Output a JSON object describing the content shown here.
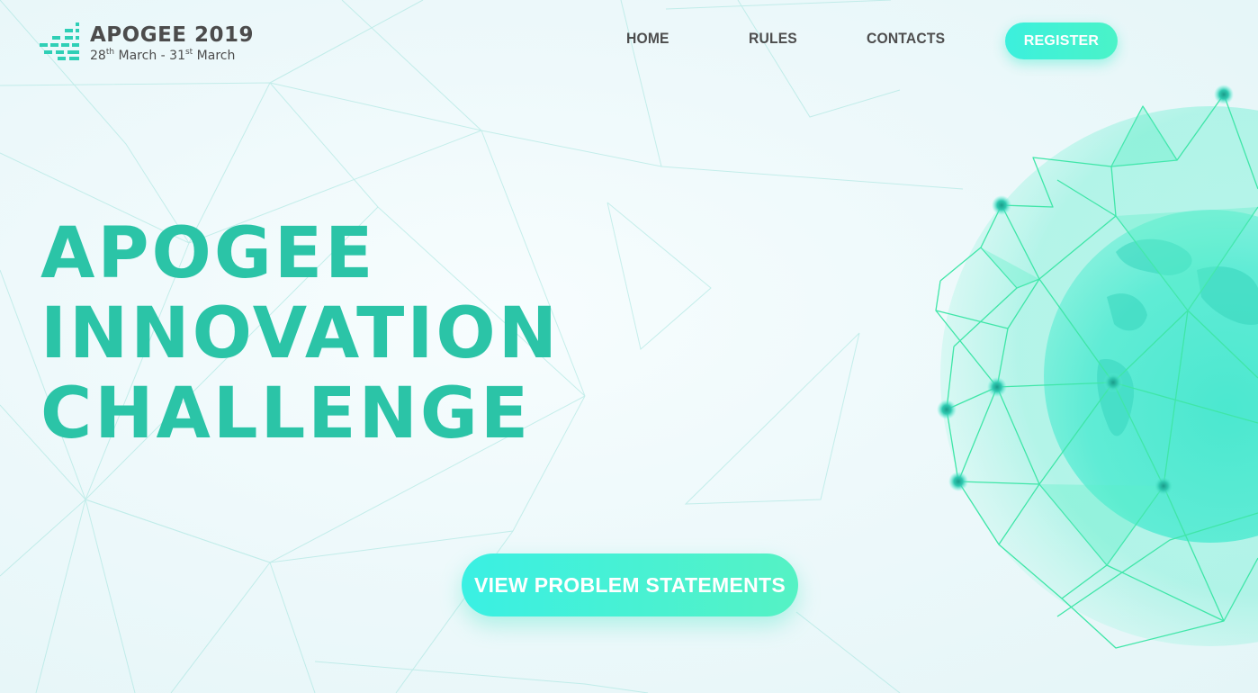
{
  "header": {
    "logo": {
      "title": "APOGEE 2019",
      "date_start_num": "28",
      "date_start_sup": "th",
      "date_start_month": "March -",
      "date_end_num": "31",
      "date_end_sup": "st",
      "date_end_month": "March"
    },
    "nav": {
      "home": "HOME",
      "rules": "RULES",
      "contacts": "CONTACTS"
    },
    "register_label": "REGISTER"
  },
  "hero": {
    "title_lines": [
      "APOGEE",
      "INNOVATION",
      "CHALLENGE"
    ],
    "cta_label": "VIEW PROBLEM STATEMENTS"
  },
  "theme": {
    "accent": "#2bc4a7",
    "button_gradient_start": "#3af0e3",
    "button_gradient_end": "#55f2c4",
    "nav_text": "#4d4d4d",
    "background": "#eef9fb"
  },
  "icons": {
    "logo_mark": "equalizer-bars-logo-icon",
    "globe": "polygon-network-globe-illustration"
  }
}
